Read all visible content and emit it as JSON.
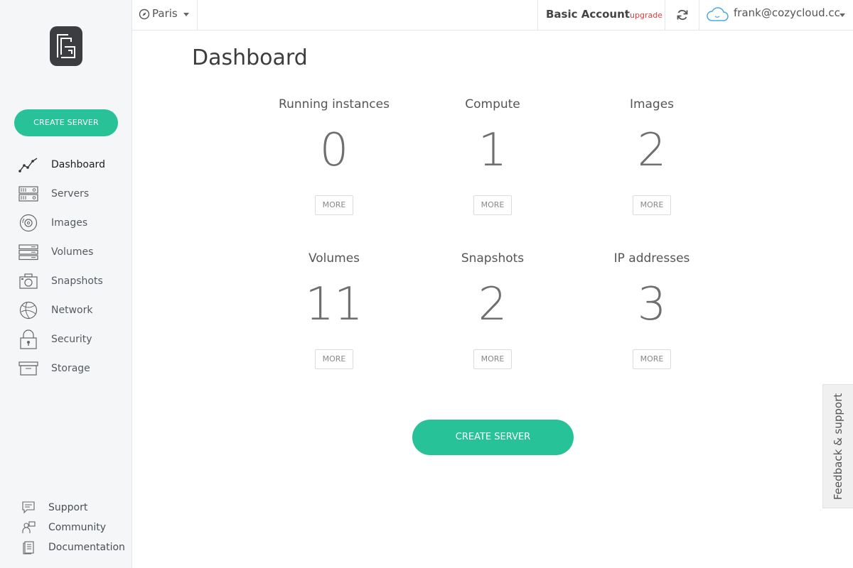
{
  "sidebar": {
    "create_label": "CREATE SERVER",
    "items": [
      {
        "label": "Dashboard",
        "icon": "chart-line-icon"
      },
      {
        "label": "Servers",
        "icon": "server-icon"
      },
      {
        "label": "Images",
        "icon": "disc-icon"
      },
      {
        "label": "Volumes",
        "icon": "volume-icon"
      },
      {
        "label": "Snapshots",
        "icon": "camera-icon"
      },
      {
        "label": "Network",
        "icon": "globe-icon"
      },
      {
        "label": "Security",
        "icon": "lock-icon"
      },
      {
        "label": "Storage",
        "icon": "box-icon"
      }
    ],
    "bottom": [
      {
        "label": "Support",
        "icon": "chat-icon"
      },
      {
        "label": "Community",
        "icon": "users-icon"
      },
      {
        "label": "Documentation",
        "icon": "document-icon"
      }
    ]
  },
  "topbar": {
    "region": "Paris",
    "account_name": "Basic Account",
    "upgrade": "upgrade",
    "user_email": "frank@cozycloud.cc"
  },
  "main": {
    "title": "Dashboard",
    "more_label": "MORE",
    "stats": [
      {
        "title": "Running instances",
        "value": "0"
      },
      {
        "title": "Compute",
        "value": "1"
      },
      {
        "title": "Images",
        "value": "2"
      },
      {
        "title": "Volumes",
        "value": "11"
      },
      {
        "title": "Snapshots",
        "value": "2"
      },
      {
        "title": "IP addresses",
        "value": "3"
      }
    ],
    "create_label": "CREATE SERVER"
  },
  "feedback_label": "Feedback & support",
  "colors": {
    "accent": "#27c297",
    "upgrade": "#e23b3b",
    "sidebar_bg": "#f5f6f8"
  }
}
